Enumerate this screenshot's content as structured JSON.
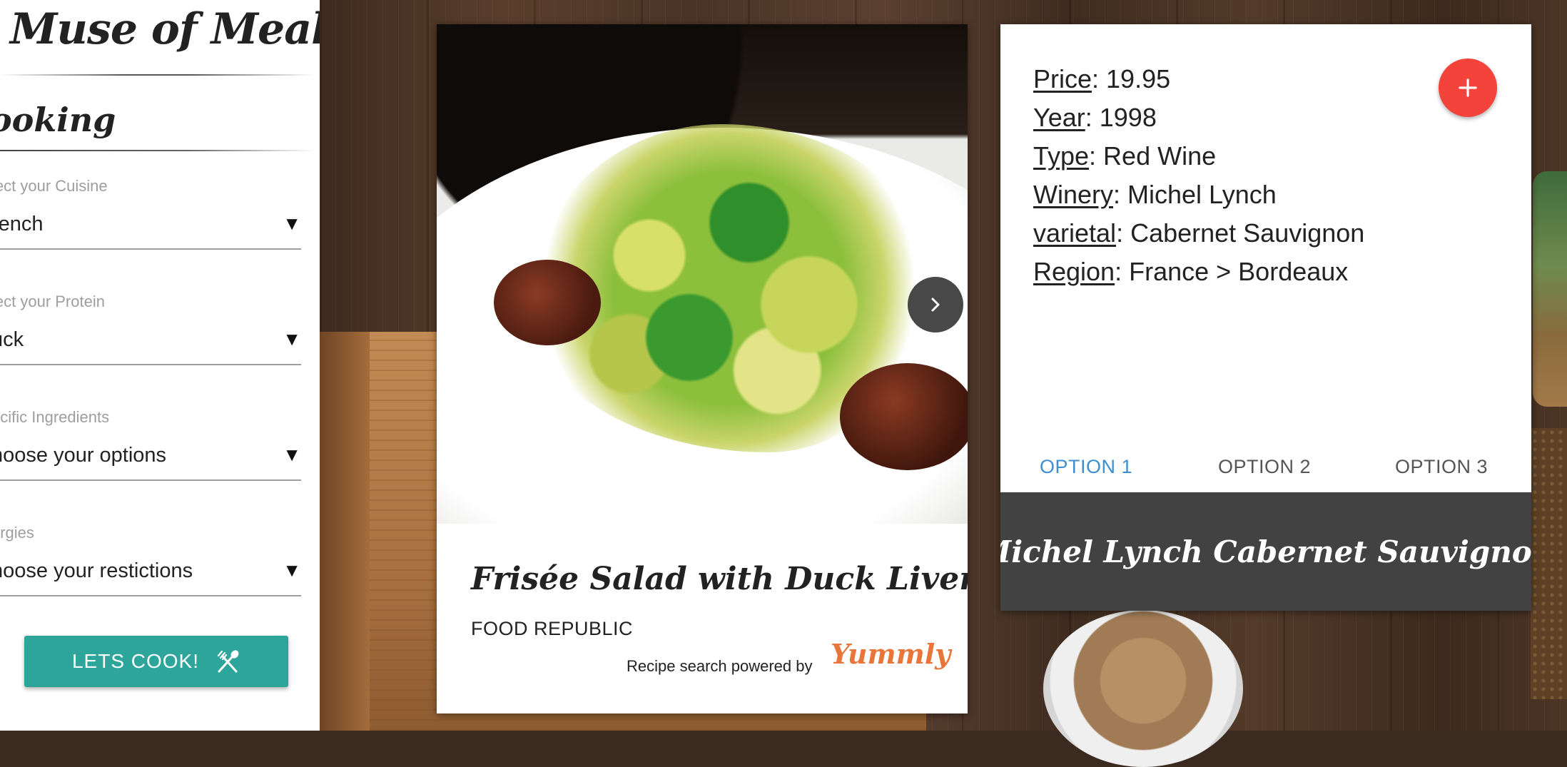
{
  "app": {
    "brand": "Muse of Meals"
  },
  "sidebar": {
    "section_title": "ooking",
    "fields": [
      {
        "label": "lect your Cuisine",
        "value": "rench"
      },
      {
        "label": "lect your Protein",
        "value": "uck"
      },
      {
        "label": "ecific Ingredients",
        "value": "hoose your options"
      },
      {
        "label": "ergies",
        "value": "hoose your restictions"
      }
    ],
    "caret_icon": "▼",
    "cook_button": {
      "label": "LETS COOK!",
      "icon": "utensils-icon"
    }
  },
  "recipe": {
    "title": "Frisée Salad with Duck Livers",
    "source": "FOOD REPUBLIC",
    "powered_by": "Recipe search powered by",
    "provider_logo": "Yummly",
    "next_icon": "chevron-right-icon"
  },
  "wine": {
    "details": [
      {
        "key": "Price",
        "value": ": 19.95"
      },
      {
        "key": "Year",
        "value": ": 1998"
      },
      {
        "key": "Type",
        "value": ": Red Wine"
      },
      {
        "key": "Winery",
        "value": ": Michel Lynch"
      },
      {
        "key": "varietal",
        "value": ": Cabernet Sauvignon"
      },
      {
        "key": "Region",
        "value": ": France > Bordeaux"
      }
    ],
    "add_icon": "plus-icon",
    "tabs": [
      "OPTION 1",
      "OPTION 2",
      "OPTION 3"
    ],
    "active_tab": 0,
    "name": "Michel Lynch Cabernet Sauvignon"
  },
  "colors": {
    "accent_teal": "#2ea59a",
    "tab_active": "#3d8fd1",
    "add_red": "#f4433a",
    "name_bar": "#424242",
    "yummly_orange": "#e8763a"
  }
}
